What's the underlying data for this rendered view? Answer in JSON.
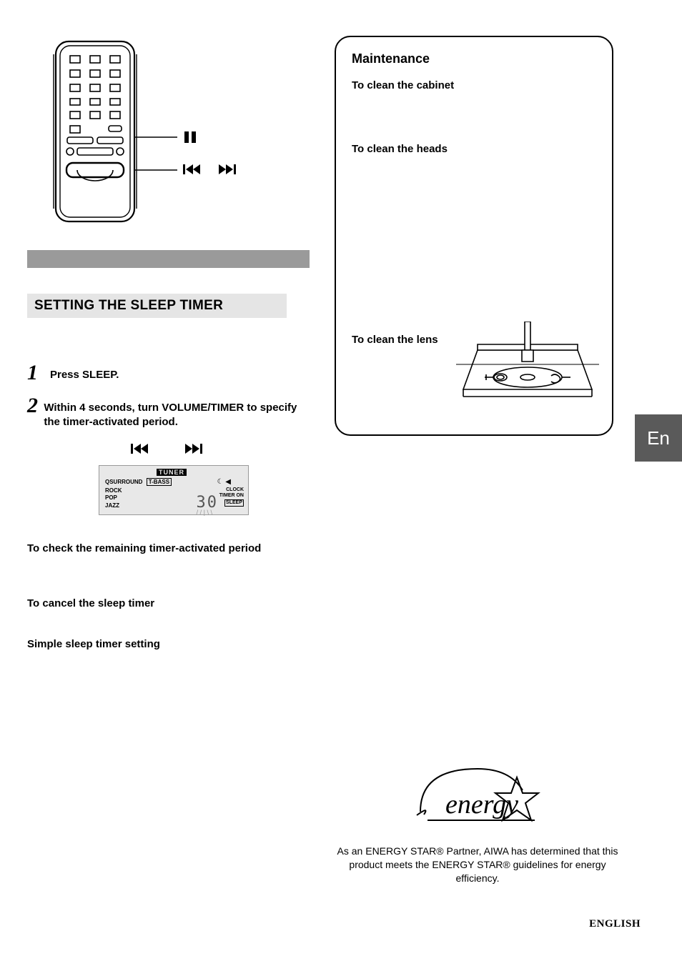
{
  "remote": {
    "pause_icon": "pause-icon",
    "prev_icon": "skip-back-icon",
    "next_icon": "skip-forward-icon"
  },
  "left": {
    "section_title": "SETTING THE SLEEP TIMER",
    "step1_num": "1",
    "step1_text": "Press SLEEP.",
    "step2_num": "2",
    "step2_text": "Within 4 seconds, turn VOLUME/TIMER to specify the timer-activated period.",
    "lcd": {
      "tuner": "TUNER",
      "qsurround": "QSURROUND",
      "tbass": "T-BASS",
      "rock": "ROCK",
      "pop": "POP",
      "jazz": "JAZZ",
      "clock": "CLOCK",
      "timer_on": "TIMER ON",
      "sleep": "SLEEP",
      "number": "30",
      "moon": "☾ ◀"
    },
    "sub_check": "To check the remaining timer-activated period",
    "sub_cancel": "To cancel the sleep timer",
    "sub_simple": "Simple sleep timer setting"
  },
  "maintenance": {
    "title": "Maintenance",
    "cabinet": "To clean the cabinet",
    "heads": "To clean the heads",
    "lens": "To clean the lens"
  },
  "lang_tab": "En",
  "energy": {
    "text": "As an ENERGY STAR® Partner, AIWA has determined that this product meets the ENERGY STAR® guidelines for energy efficiency."
  },
  "footer_lang": "ENGLISH"
}
